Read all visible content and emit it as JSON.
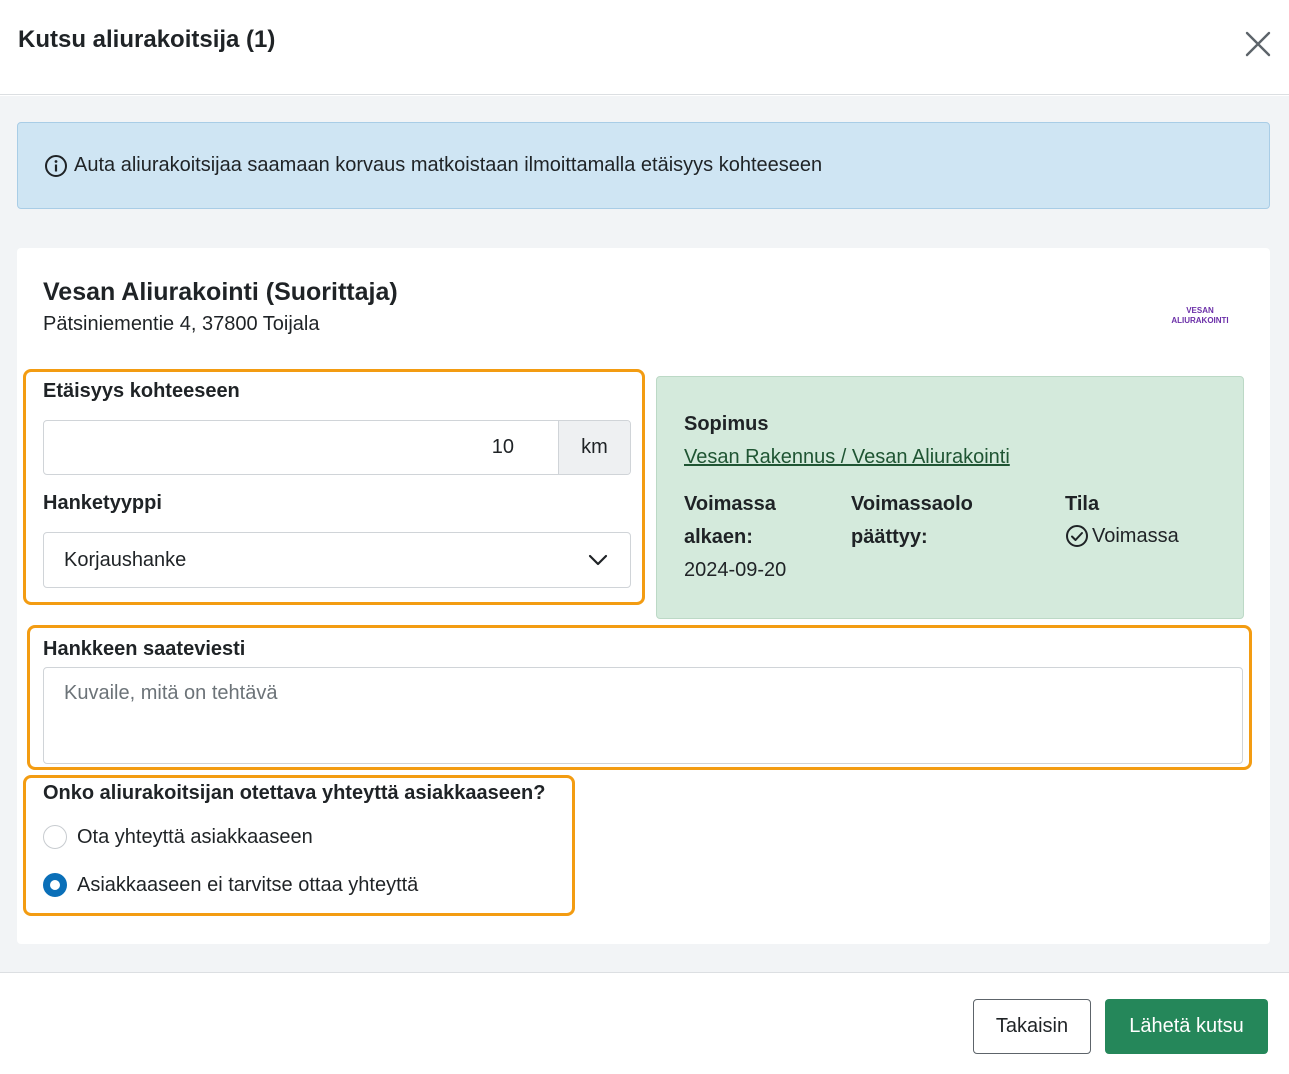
{
  "dialog": {
    "title": "Kutsu aliurakoitsija (1)"
  },
  "info_banner": {
    "text": "Auta aliurakoitsijaa saamaan korvaus matkoistaan ilmoittamalla etäisyys kohteeseen"
  },
  "subcontractor": {
    "name": "Vesan Aliurakointi (Suorittaja)",
    "address": "Pätsiniementie 4, 37800 Toijala",
    "logo_line1": "VESAN",
    "logo_line2": "ALIURAKOINTI"
  },
  "form": {
    "distance_label": "Etäisyys kohteeseen",
    "distance_value": "10",
    "distance_unit": "km",
    "project_type_label": "Hanketyyppi",
    "project_type_value": "Korjaushanke",
    "message_label": "Hankkeen saateviesti",
    "message_placeholder": "Kuvaile, mitä on tehtävä",
    "contact_question": "Onko aliurakoitsijan otettava yhteyttä asiakkaaseen?",
    "contact_options": [
      {
        "label": "Ota yhteyttä asiakkaaseen",
        "selected": false
      },
      {
        "label": "Asiakkaaseen ei tarvitse ottaa yhteyttä",
        "selected": true
      }
    ]
  },
  "contract": {
    "title": "Sopimus",
    "link": "Vesan Rakennus / Vesan Aliurakointi",
    "valid_from_label_1": "Voimassa",
    "valid_from_label_2": "alkaen:",
    "valid_from_value": "2024-09-20",
    "valid_to_label_1": "Voimassaolo",
    "valid_to_label_2": "päättyy:",
    "status_label": "Tila",
    "status_value": "Voimassa"
  },
  "footer": {
    "back_label": "Takaisin",
    "send_label": "Lähetä kutsu"
  },
  "colors": {
    "highlight": "#f39c12",
    "primary_button": "#25875a",
    "info_bg": "#cfe5f3",
    "contract_bg": "#d4eadc",
    "radio_selected": "#0a6fb8"
  }
}
